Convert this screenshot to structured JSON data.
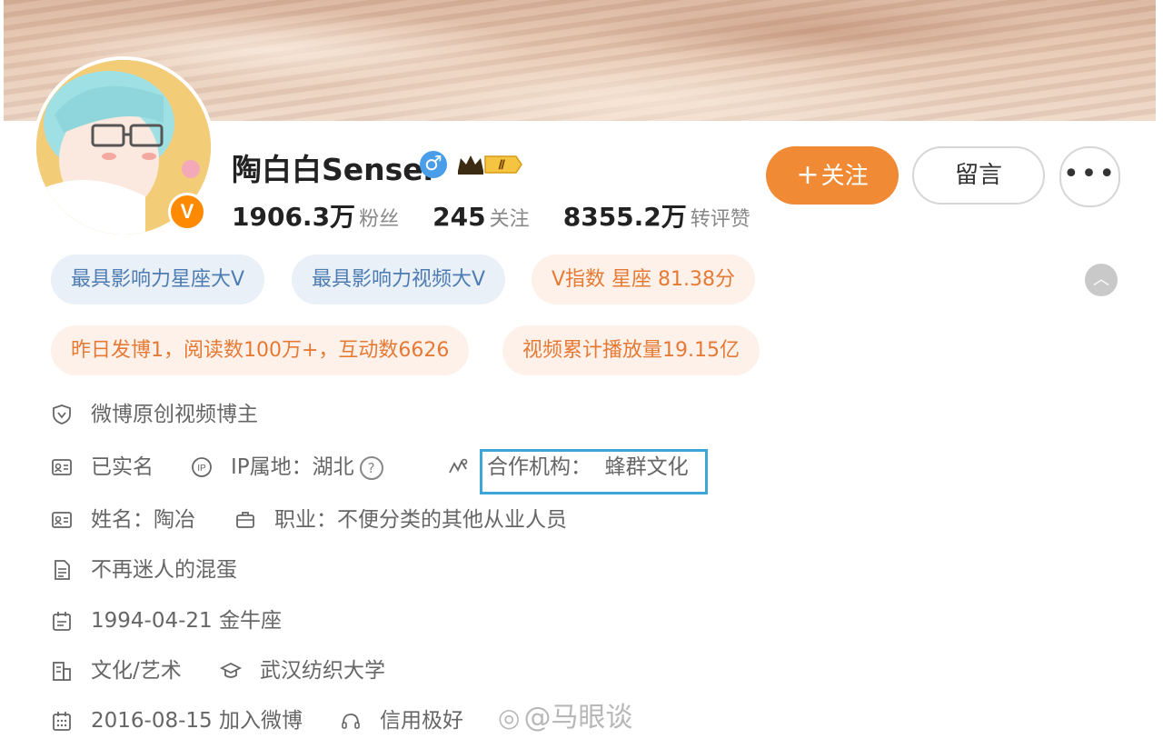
{
  "profile": {
    "name": "陶白白Sensei",
    "gender_icon": "male",
    "vip_level": "Ⅱ",
    "verified_badge": "V",
    "stats": [
      {
        "value": "1906.3万",
        "label": "粉丝"
      },
      {
        "value": "245",
        "label": "关注"
      },
      {
        "value": "8355.2万",
        "label": "转评赞"
      }
    ]
  },
  "actions": {
    "follow_plus": "+",
    "follow_label": "关注",
    "message_label": "留言",
    "more_label": "•••"
  },
  "tags": {
    "row1": [
      "最具影响力星座大V",
      "最具影响力视频大V",
      "V指数 星座 81.38分"
    ],
    "row2": [
      "昨日发博1，阅读数100万+，互动数6626",
      "视频累计播放量19.15亿"
    ],
    "collapse_icon": "chevron-up-icon"
  },
  "info": {
    "certification": "微博原创视频博主",
    "real_name_status": "已实名",
    "ip_location": "IP属地：湖北",
    "help_mark": "?",
    "org_label": "合作机构：",
    "org_value": "蜂群文化",
    "name_label": "姓名：陶冶",
    "occupation": "职业：不便分类的其他从业人员",
    "bio": "不再迷人的混蛋",
    "birthday": "1994-04-21 金牛座",
    "category": "文化/艺术",
    "school": "武汉纺织大学",
    "joined": "2016-08-15 加入微博",
    "credit": "信用极好"
  },
  "watermark": "@马眼谈",
  "colors": {
    "accent": "#f08a35",
    "tag_blue_bg": "#eaf0f7",
    "tag_blue_text": "#4d7cb3",
    "tag_orange_bg": "#fdf1ea",
    "tag_orange_text": "#e67a35",
    "highlight_box": "#3da6d8"
  }
}
